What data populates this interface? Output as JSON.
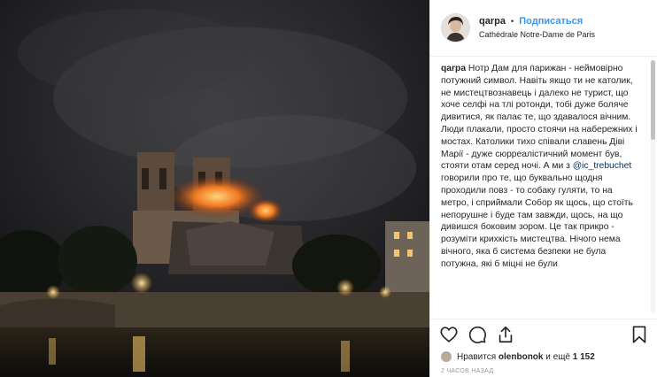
{
  "header": {
    "username": "qarpa",
    "separator": "•",
    "follow_label": "Подписаться",
    "location": "Cathédrale Notre-Dame de Paris"
  },
  "caption": {
    "username": "qarpa",
    "text_before_mention": "Нотр Дам для парижан - неймовірно потужний символ. Навіть якщо ти не католик, не мистецтвознавець і далеко не турист, що хоче селфі на тлі ротонди, тобі дуже боляче дивитися, як палає те, що здавалося вічним. Люди плакали, просто стоячи на набережних і мостах. Католики тихо співали славень Діві Марії - дуже сюрреалістичний момент був, стояти отам серед ночі. А ми з",
    "mention": "@ic_trebuchet",
    "text_after_mention": "говорили про те, що буквально щодня проходили повз - то собаку гуляти, то на метро, і сприймали Собор як щось, що стоїть непорушне і буде там завжди, щось, на що дивишся боковим зором. Це так прикро - розуміти крихкість мистецтва. Нічого нема вічного, яка б система безпеки не була потужна, які б міцні не були"
  },
  "actions": {
    "like": "heart-icon",
    "comment": "comment-icon",
    "share": "share-icon",
    "save": "bookmark-icon"
  },
  "likes": {
    "prefix": "Нравится",
    "user": "olenbonok",
    "middle": "и ещё",
    "count": "1 152"
  },
  "timestamp": "2 ЧАСОВ НАЗАД",
  "colors": {
    "accent": "#3897f0",
    "text": "#262626",
    "muted": "#999999",
    "border": "#efefef"
  }
}
